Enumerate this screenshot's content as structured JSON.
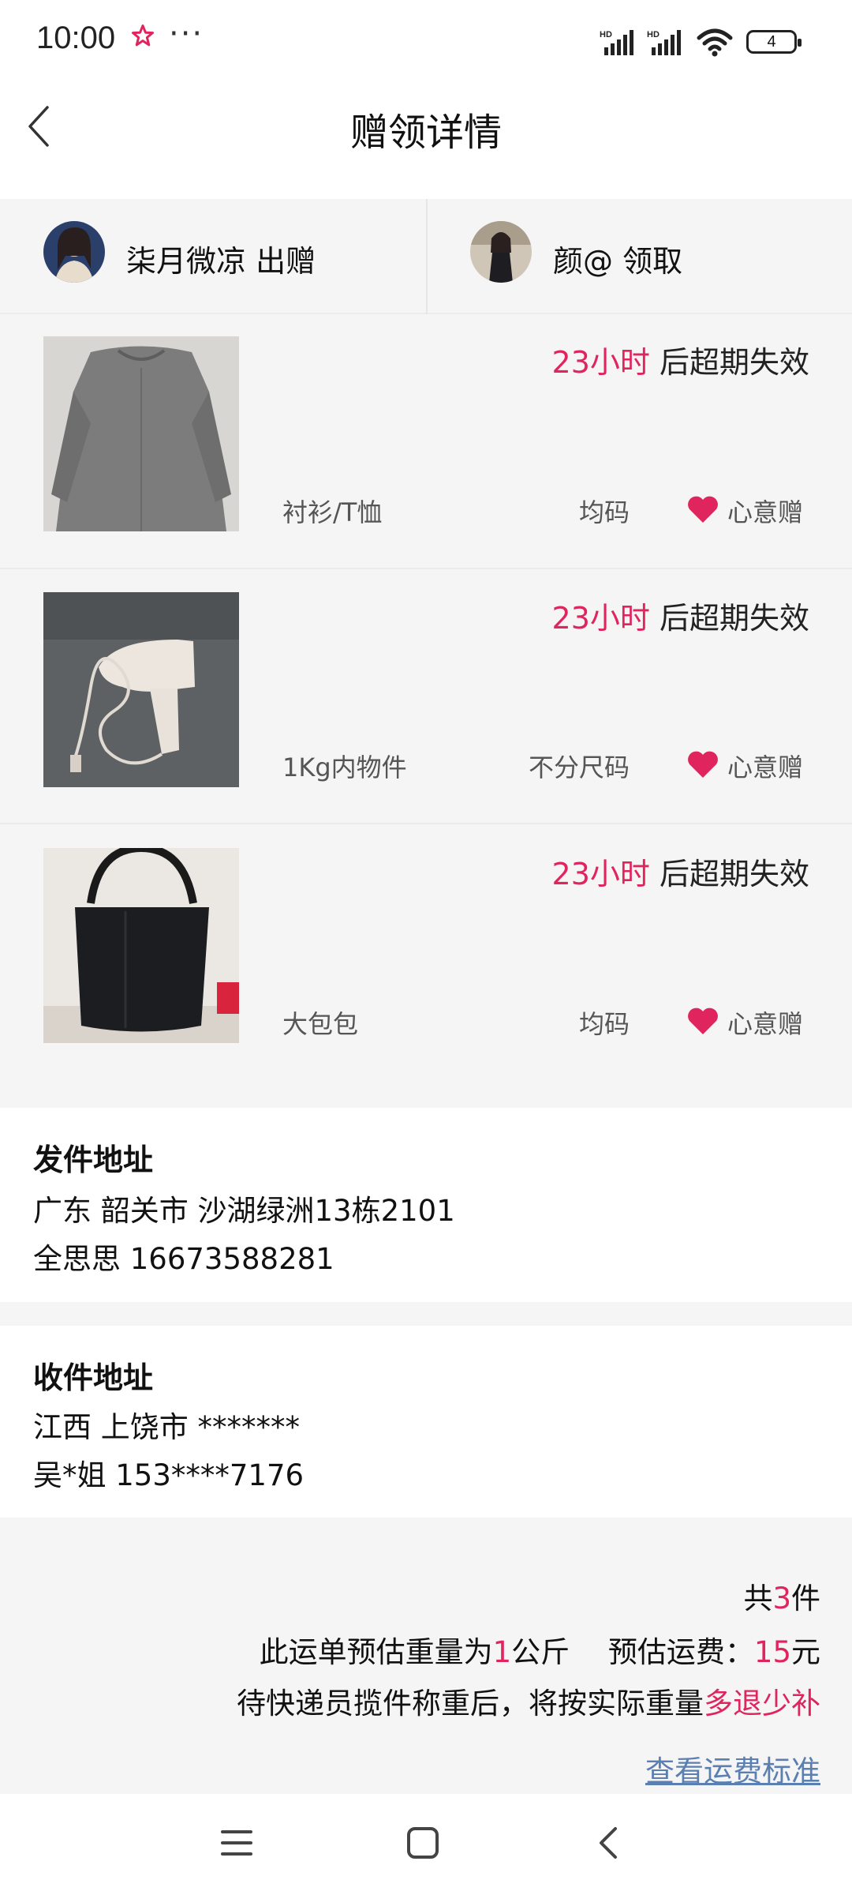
{
  "status_bar": {
    "time": "10:00",
    "star": "☆",
    "dots": "···",
    "battery": "4",
    "signal_labels": [
      "HD",
      "HD"
    ]
  },
  "header": {
    "title": "赠领详情"
  },
  "parties": {
    "giver": "柒月微凉 出赠",
    "receiver": "颜@ 领取"
  },
  "items": [
    {
      "expire_hours": "23小时",
      "expire_suffix": " 后超期失效",
      "category": "衬衫/T恤",
      "size": "均码",
      "gift": "心意赠"
    },
    {
      "expire_hours": "23小时",
      "expire_suffix": " 后超期失效",
      "category": "1Kg内物件",
      "size": "不分尺码",
      "gift": "心意赠"
    },
    {
      "expire_hours": "23小时",
      "expire_suffix": " 后超期失效",
      "category": "大包包",
      "size": "均码",
      "gift": "心意赠"
    }
  ],
  "sender": {
    "heading": "发件地址",
    "address": "广东 韶关市 沙湖绿洲13栋2101",
    "contact": "全思思 16673588281"
  },
  "recipient": {
    "heading": "收件地址",
    "address": "江西 上饶市 *******",
    "contact": "吴*姐 153****7176"
  },
  "summary": {
    "count_prefix": "共",
    "count": "3",
    "count_suffix": "件",
    "weight_prefix": "此运单预估重量为",
    "weight": "1",
    "weight_suffix": "公斤　 预估运费：",
    "fee": "15",
    "fee_unit": "元",
    "note_prefix": "待快递员揽件称重后，将按实际重量",
    "note_highlight": "多退少补",
    "link": "查看运费标准"
  },
  "colors": {
    "accent": "#e0245e",
    "link": "#5b7fb0",
    "background": "#f5f5f5"
  }
}
